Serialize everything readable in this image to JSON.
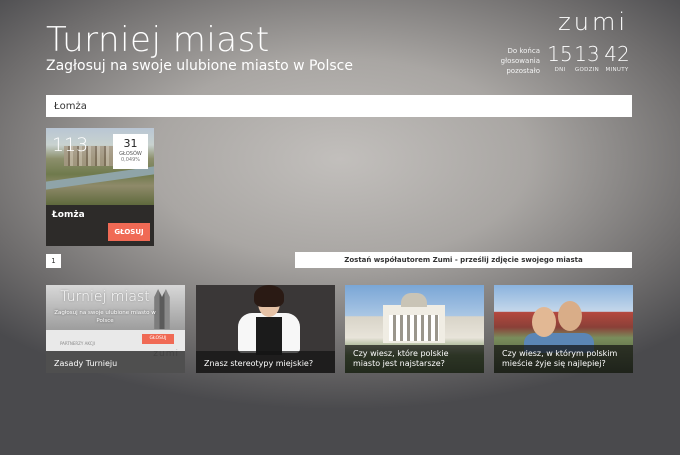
{
  "header": {
    "title": "Turniej miast",
    "subtitle": "Zagłosuj na swoje ulubione miasto w Polsce",
    "logo": "zumi"
  },
  "countdown": {
    "label": "Do końca głosowania pozostało",
    "days": {
      "value": "15",
      "unit": "DNI"
    },
    "hours": {
      "value": "13",
      "unit": "GODZIN"
    },
    "minutes": {
      "value": "42",
      "unit": "MINUTY"
    }
  },
  "search": {
    "value": "Łomża",
    "placeholder": ""
  },
  "city_card": {
    "rank": "113",
    "votes": "31",
    "votes_label": "GŁOSÓW",
    "percent": "0,049%",
    "name": "Łomża",
    "vote_button": "GŁOSUJ"
  },
  "pagination": {
    "current_page": "1"
  },
  "cta_button": "Zostań współautorem Zumi - prześlij zdjęcie swojego miasta",
  "tiles": [
    {
      "caption": "Zasady Turnieju",
      "mini_title": "Turniej miast",
      "mini_subtitle": "Zagłosuj na swoje ulubione miasto w Polsce",
      "mini_button": "GŁOSUJ",
      "mini_partner": "PARTNERZY AKCJI",
      "mini_logo": "zumi"
    },
    {
      "caption": "Znasz stereotypy miejskie?"
    },
    {
      "caption": "Czy wiesz, które polskie miasto jest najstarsze?"
    },
    {
      "caption": "Czy wiesz, w którym polskim mieście żyje się najlepiej?"
    }
  ],
  "colors": {
    "accent": "#f06a55",
    "card_bg": "#2d2b29"
  }
}
